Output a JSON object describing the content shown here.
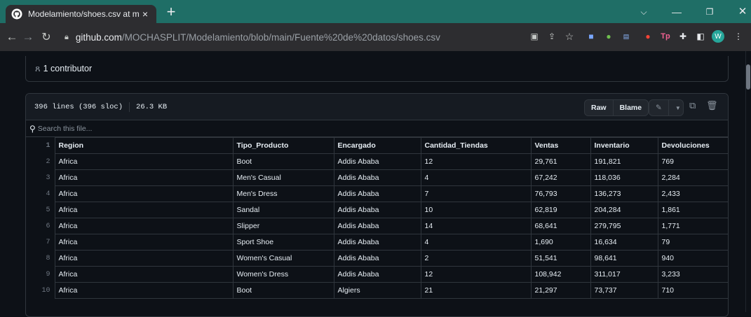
{
  "browser": {
    "tab_title": "Modelamiento/shoes.csv at main",
    "tab_close": "×",
    "new_tab": "+",
    "url_host": "github.com",
    "url_path": "/MOCHASPLIT/Modelamiento/blob/main/Fuente%20de%20datos/shoes.csv",
    "profile_initial": "W",
    "accent_color": "#1f6e66"
  },
  "contributors": {
    "label": "1 contributor"
  },
  "file": {
    "lines": "396 lines (396 sloc)",
    "size": "26.3 KB",
    "raw_label": "Raw",
    "blame_label": "Blame",
    "search_placeholder": "Search this file..."
  },
  "table": {
    "columns": [
      "Region",
      "Tipo_Producto",
      "Encargado",
      "Cantidad_Tiendas",
      "Ventas",
      "Inventario",
      "Devoluciones"
    ],
    "rows": [
      {
        "ln": "2",
        "cells": [
          "Africa",
          "Boot",
          "Addis Ababa",
          "12",
          "29,761",
          "191,821",
          "769"
        ]
      },
      {
        "ln": "3",
        "cells": [
          "Africa",
          "Men's Casual",
          "Addis Ababa",
          "4",
          "67,242",
          "118,036",
          "2,284"
        ]
      },
      {
        "ln": "4",
        "cells": [
          "Africa",
          "Men's Dress",
          "Addis Ababa",
          "7",
          "76,793",
          "136,273",
          "2,433"
        ]
      },
      {
        "ln": "5",
        "cells": [
          "Africa",
          "Sandal",
          "Addis Ababa",
          "10",
          "62,819",
          "204,284",
          "1,861"
        ]
      },
      {
        "ln": "6",
        "cells": [
          "Africa",
          "Slipper",
          "Addis Ababa",
          "14",
          "68,641",
          "279,795",
          "1,771"
        ]
      },
      {
        "ln": "7",
        "cells": [
          "Africa",
          "Sport Shoe",
          "Addis Ababa",
          "4",
          "1,690",
          "16,634",
          "79"
        ]
      },
      {
        "ln": "8",
        "cells": [
          "Africa",
          "Women's Casual",
          "Addis Ababa",
          "2",
          "51,541",
          "98,641",
          "940"
        ]
      },
      {
        "ln": "9",
        "cells": [
          "Africa",
          "Women's Dress",
          "Addis Ababa",
          "12",
          "108,942",
          "311,017",
          "3,233"
        ]
      },
      {
        "ln": "10",
        "cells": [
          "Africa",
          "Boot",
          "Algiers",
          "21",
          "21,297",
          "73,737",
          "710"
        ]
      }
    ]
  }
}
